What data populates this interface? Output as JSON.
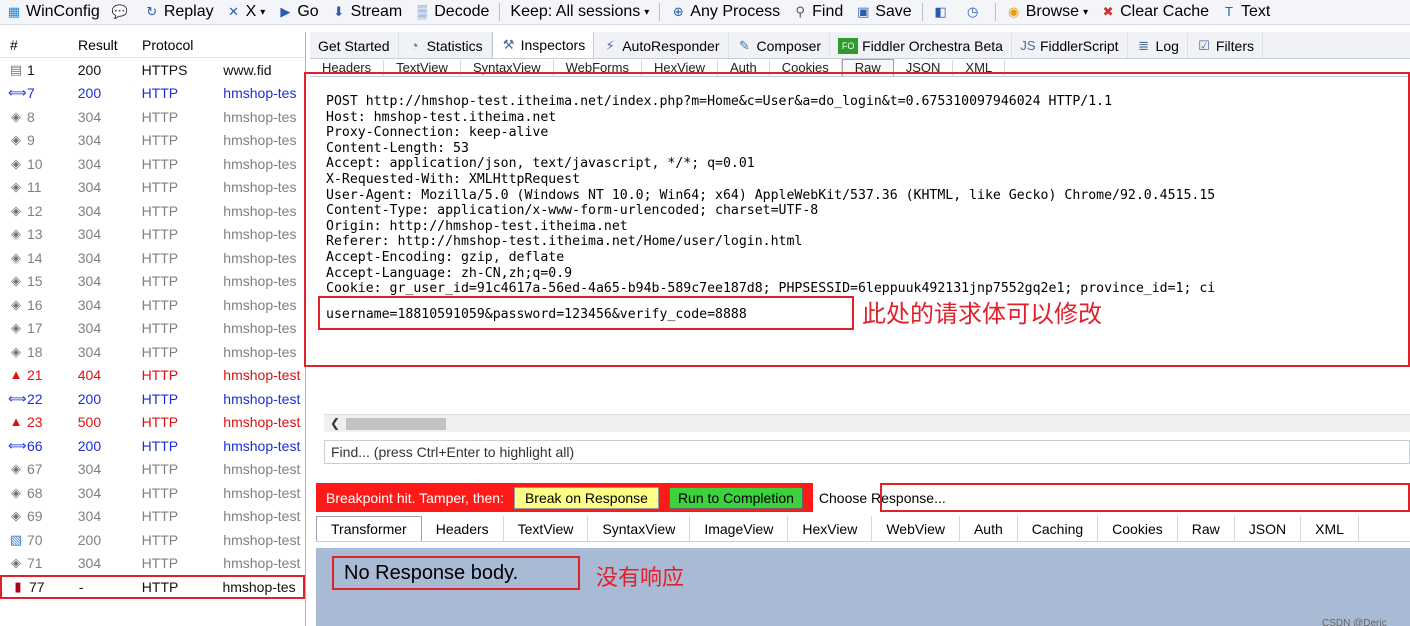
{
  "toolbar": {
    "items": [
      {
        "label": "WinConfig",
        "icon": "windows-icon"
      },
      {
        "label": "",
        "icon": "comment-icon"
      },
      {
        "label": "Replay",
        "icon": "replay-icon"
      },
      {
        "label": "X",
        "icon": "remove-icon",
        "dropdown": true
      },
      {
        "label": "Go",
        "icon": "play-icon"
      },
      {
        "label": "Stream",
        "icon": "stream-icon"
      },
      {
        "label": "Decode",
        "icon": "decode-icon"
      },
      {
        "label": "Keep: All sessions",
        "icon": "",
        "dropdown": true
      },
      {
        "label": "Any Process",
        "icon": "crosshair-icon"
      },
      {
        "label": "Find",
        "icon": "binoculars-icon"
      },
      {
        "label": "Save",
        "icon": "save-icon"
      },
      {
        "label": "",
        "icon": "screenshot-icon"
      },
      {
        "label": "",
        "icon": "timer-icon"
      },
      {
        "label": "Browse",
        "icon": "browser-icon",
        "dropdown": true
      },
      {
        "label": "Clear Cache",
        "icon": "clear-cache-icon"
      },
      {
        "label": "Text",
        "icon": "text-wizard-icon"
      }
    ]
  },
  "sessions": {
    "headers": {
      "num": "#",
      "result": "Result",
      "protocol": "Protocol"
    },
    "rows": [
      {
        "num": "1",
        "result": "200",
        "protocol": "HTTPS",
        "host": "www.fid",
        "style": "black",
        "icon": "doc-icon"
      },
      {
        "num": "7",
        "result": "200",
        "protocol": "HTTP",
        "host": "hmshop-tes",
        "style": "blue",
        "icon": "ajax-icon"
      },
      {
        "num": "8",
        "result": "304",
        "protocol": "HTTP",
        "host": "hmshop-tes",
        "style": "gray",
        "icon": "cache-icon"
      },
      {
        "num": "9",
        "result": "304",
        "protocol": "HTTP",
        "host": "hmshop-tes",
        "style": "gray",
        "icon": "cache-icon"
      },
      {
        "num": "10",
        "result": "304",
        "protocol": "HTTP",
        "host": "hmshop-tes",
        "style": "gray",
        "icon": "cache-icon"
      },
      {
        "num": "11",
        "result": "304",
        "protocol": "HTTP",
        "host": "hmshop-tes",
        "style": "gray",
        "icon": "cache-icon"
      },
      {
        "num": "12",
        "result": "304",
        "protocol": "HTTP",
        "host": "hmshop-tes",
        "style": "gray",
        "icon": "cache-icon"
      },
      {
        "num": "13",
        "result": "304",
        "protocol": "HTTP",
        "host": "hmshop-tes",
        "style": "gray",
        "icon": "cache-icon"
      },
      {
        "num": "14",
        "result": "304",
        "protocol": "HTTP",
        "host": "hmshop-tes",
        "style": "gray",
        "icon": "cache-icon"
      },
      {
        "num": "15",
        "result": "304",
        "protocol": "HTTP",
        "host": "hmshop-tes",
        "style": "gray",
        "icon": "cache-icon"
      },
      {
        "num": "16",
        "result": "304",
        "protocol": "HTTP",
        "host": "hmshop-tes",
        "style": "gray",
        "icon": "cache-icon"
      },
      {
        "num": "17",
        "result": "304",
        "protocol": "HTTP",
        "host": "hmshop-tes",
        "style": "gray",
        "icon": "cache-icon"
      },
      {
        "num": "18",
        "result": "304",
        "protocol": "HTTP",
        "host": "hmshop-tes",
        "style": "gray",
        "icon": "cache-icon"
      },
      {
        "num": "21",
        "result": "404",
        "protocol": "HTTP",
        "host": "hmshop-test",
        "style": "red",
        "icon": "warning-icon"
      },
      {
        "num": "22",
        "result": "200",
        "protocol": "HTTP",
        "host": "hmshop-test",
        "style": "blue",
        "icon": "ajax-icon"
      },
      {
        "num": "23",
        "result": "500",
        "protocol": "HTTP",
        "host": "hmshop-test",
        "style": "red",
        "icon": "warning-icon"
      },
      {
        "num": "66",
        "result": "200",
        "protocol": "HTTP",
        "host": "hmshop-test",
        "style": "blue",
        "icon": "ajax-icon"
      },
      {
        "num": "67",
        "result": "304",
        "protocol": "HTTP",
        "host": "hmshop-test",
        "style": "gray",
        "icon": "cache-icon"
      },
      {
        "num": "68",
        "result": "304",
        "protocol": "HTTP",
        "host": "hmshop-test",
        "style": "gray",
        "icon": "cache-icon"
      },
      {
        "num": "69",
        "result": "304",
        "protocol": "HTTP",
        "host": "hmshop-test",
        "style": "gray",
        "icon": "cache-icon"
      },
      {
        "num": "70",
        "result": "200",
        "protocol": "HTTP",
        "host": "hmshop-test",
        "style": "gray",
        "icon": "image-icon"
      },
      {
        "num": "71",
        "result": "304",
        "protocol": "HTTP",
        "host": "hmshop-test",
        "style": "gray",
        "icon": "cache-icon"
      },
      {
        "num": "77",
        "result": "-",
        "protocol": "HTTP",
        "host": "hmshop-tes",
        "style": "black",
        "icon": "breakpoint-icon",
        "selected": true
      }
    ]
  },
  "tabs": [
    {
      "label": "Get Started",
      "icon": ""
    },
    {
      "label": "Statistics",
      "icon": "statistics-icon"
    },
    {
      "label": "Inspectors",
      "icon": "inspectors-icon",
      "active": true
    },
    {
      "label": "AutoResponder",
      "icon": "autoresponder-icon"
    },
    {
      "label": "Composer",
      "icon": "composer-icon"
    },
    {
      "label": "Fiddler Orchestra Beta",
      "icon": "fo-icon"
    },
    {
      "label": "FiddlerScript",
      "icon": "script-icon"
    },
    {
      "label": "Log",
      "icon": "log-icon"
    },
    {
      "label": "Filters",
      "icon": "filters-icon"
    }
  ],
  "request_subtabs": [
    "Headers",
    "TextView",
    "SyntaxView",
    "WebForms",
    "HexView",
    "Auth",
    "Cookies",
    "Raw",
    "JSON",
    "XML"
  ],
  "request_active_subtab": "Raw",
  "raw_lines": [
    "POST http://hmshop-test.itheima.net/index.php?m=Home&c=User&a=do_login&t=0.675310097946024 HTTP/1.1",
    "Host: hmshop-test.itheima.net",
    "Proxy-Connection: keep-alive",
    "Content-Length: 53",
    "Accept: application/json, text/javascript, */*; q=0.01",
    "X-Requested-With: XMLHttpRequest",
    "User-Agent: Mozilla/5.0 (Windows NT 10.0; Win64; x64) AppleWebKit/537.36 (KHTML, like Gecko) Chrome/92.0.4515.15",
    "Content-Type: application/x-www-form-urlencoded; charset=UTF-8",
    "Origin: http://hmshop-test.itheima.net",
    "Referer: http://hmshop-test.itheima.net/Home/user/login.html",
    "Accept-Encoding: gzip, deflate",
    "Accept-Language: zh-CN,zh;q=0.9",
    "Cookie: gr_user_id=91c4617a-56ed-4a65-b94b-589c7ee187d8; PHPSESSID=6leppuuk492131jnp7552gq2e1; province_id=1; ci"
  ],
  "request_body": "username=18810591059&password=123456&verify_code=8888",
  "annotation_body": "此处的请求体可以修改",
  "find_placeholder": "Find... (press Ctrl+Enter to highlight all)",
  "breakpoint": {
    "label": "Breakpoint hit. Tamper, then:",
    "break_on_response": "Break on Response",
    "run_to_completion": "Run to Completion",
    "choose_response": "Choose Response..."
  },
  "response_subtabs": [
    "Transformer",
    "Headers",
    "TextView",
    "SyntaxView",
    "ImageView",
    "HexView",
    "WebView",
    "Auth",
    "Caching",
    "Cookies",
    "Raw",
    "JSON",
    "XML"
  ],
  "response_active_subtab": "Transformer",
  "no_response": "No Response body.",
  "annotation_response": "没有响应",
  "watermark": "CSDN @Deric",
  "colors": {
    "annotation": "#e0202a",
    "breakpoint_bar": "#ff1a1a",
    "response_bg": "#a8bad4"
  }
}
